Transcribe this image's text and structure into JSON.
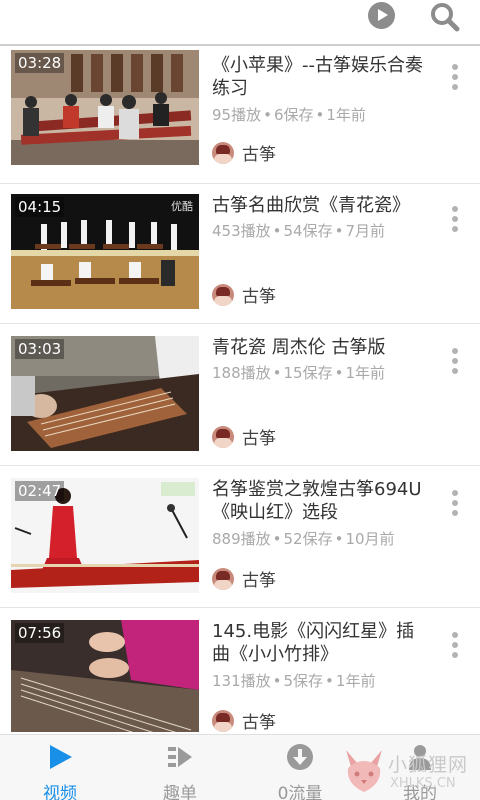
{
  "header": {
    "play_icon": "play-circle-icon",
    "search_icon": "search-icon"
  },
  "videos": [
    {
      "duration": "03:28",
      "title": "《小苹果》--古筝娱乐合奏练习",
      "plays": "95播放",
      "saves": "6保存",
      "time": "1年前",
      "uploader": "古筝",
      "thumb_scene": "ensemble-room"
    },
    {
      "duration": "04:15",
      "title": "古筝名曲欣赏《青花瓷》",
      "plays": "453播放",
      "saves": "54保存",
      "time": "7月前",
      "uploader": "古筝",
      "thumb_scene": "stage-performance",
      "thumb_mark": "优酷"
    },
    {
      "duration": "03:03",
      "title": "青花瓷 周杰伦 古筝版",
      "plays": "188播放",
      "saves": "15保存",
      "time": "1年前",
      "uploader": "古筝",
      "thumb_scene": "closeup-practice"
    },
    {
      "duration": "02:47",
      "title": "名筝鉴赏之敦煌古筝694U《映山红》选段",
      "plays": "889播放",
      "saves": "52保存",
      "time": "10月前",
      "uploader": "古筝",
      "thumb_scene": "red-dress-performer"
    },
    {
      "duration": "07:56",
      "title": "145.电影《闪闪红星》插曲《小小竹排》",
      "plays": "131播放",
      "saves": "5保存",
      "time": "1年前",
      "uploader": "古筝",
      "thumb_scene": "hands-on-strings"
    }
  ],
  "tabs": [
    {
      "label": "视频",
      "icon": "play-triangle-icon",
      "active": true
    },
    {
      "label": "趣单",
      "icon": "playlist-icon",
      "active": false
    },
    {
      "label": "0流量",
      "icon": "download-circle-icon",
      "active": false
    },
    {
      "label": "我的",
      "icon": "person-icon",
      "active": false
    }
  ],
  "watermark": {
    "text": "小狐狸网",
    "domain": "XHLKS.CN"
  },
  "colors": {
    "accent": "#1a8fe8",
    "meta_text": "#a9a9a9",
    "title_text": "#333333",
    "divider": "#e4e4e4"
  }
}
